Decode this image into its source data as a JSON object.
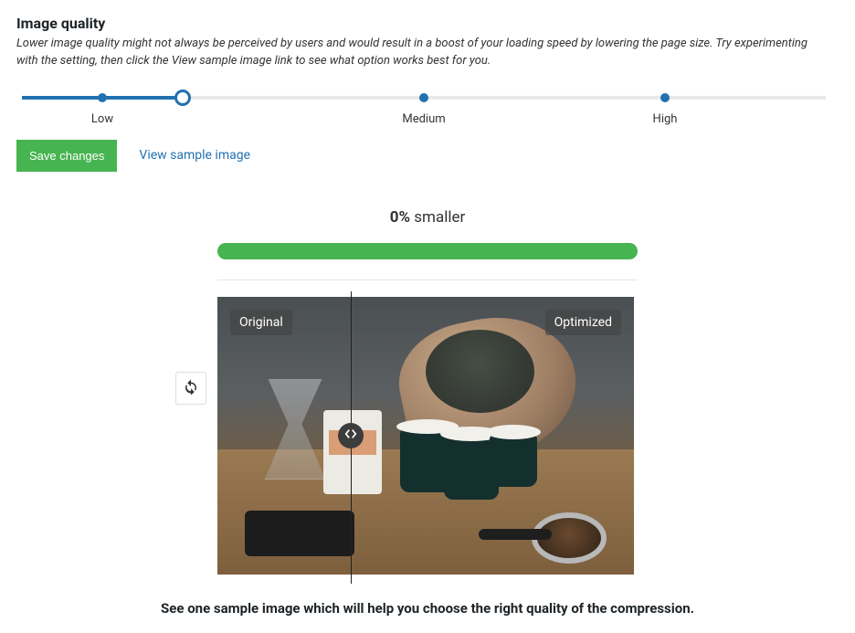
{
  "header": {
    "title": "Image quality",
    "description": "Lower image quality might not always be perceived by users and would result in a boost of your loading speed by lowering the page size. Try experimenting with the setting, then click the View sample image link to see what option works best for you."
  },
  "slider": {
    "labels": {
      "low": "Low",
      "medium": "Medium",
      "high": "High"
    }
  },
  "actions": {
    "save_label": "Save changes",
    "view_sample_label": "View sample image"
  },
  "result": {
    "percent": "0%",
    "suffix": " smaller"
  },
  "compare": {
    "original_label": "Original",
    "optimized_label": "Optimized"
  },
  "footer": {
    "caption": "See one sample image which will help you choose the right quality of the compression."
  }
}
